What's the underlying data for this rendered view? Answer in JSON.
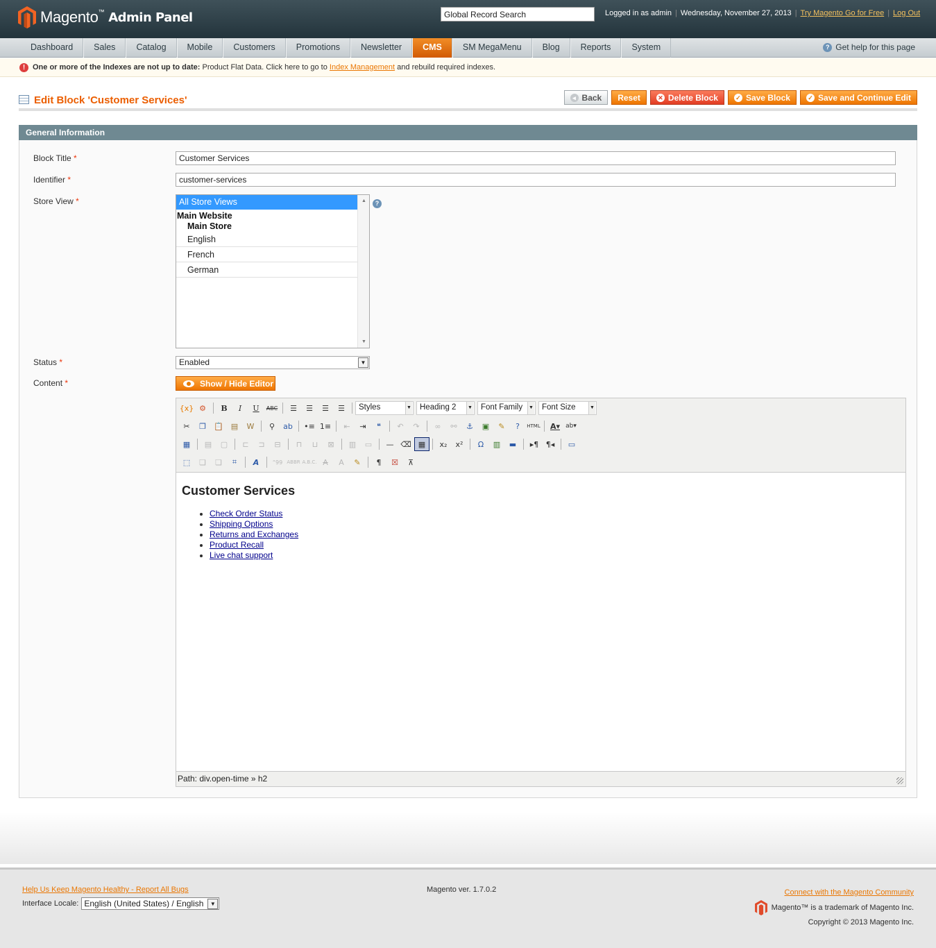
{
  "header": {
    "brand": "Magento",
    "tm": "™",
    "subtitle": "Admin Panel",
    "search_placeholder": "Global Record Search",
    "logged_in": "Logged in as admin",
    "date": "Wednesday, November 27, 2013",
    "try_link": "Try Magento Go for Free",
    "logout": "Log Out"
  },
  "nav": {
    "items": [
      "Dashboard",
      "Sales",
      "Catalog",
      "Mobile",
      "Customers",
      "Promotions",
      "Newsletter",
      "CMS",
      "SM MegaMenu",
      "Blog",
      "Reports",
      "System"
    ],
    "active": "CMS",
    "help": "Get help for this page"
  },
  "notice": {
    "bold": "One or more of the Indexes are not up to date:",
    "text": "Product Flat Data. Click here to go to",
    "link": "Index Management",
    "tail": "and rebuild required indexes."
  },
  "page": {
    "title": "Edit Block 'Customer Services'",
    "buttons": {
      "back": "Back",
      "reset": "Reset",
      "delete": "Delete Block",
      "save": "Save Block",
      "save_continue": "Save and Continue Edit"
    }
  },
  "form": {
    "section": "General Information",
    "block_title_label": "Block Title",
    "block_title": "Customer Services",
    "identifier_label": "Identifier",
    "identifier": "customer-services",
    "store_view_label": "Store View",
    "store_views": {
      "selected": "All Store Views",
      "website": "Main Website",
      "store": "Main Store",
      "views": [
        "English",
        "French",
        "German"
      ]
    },
    "status_label": "Status",
    "status": "Enabled",
    "content_label": "Content",
    "show_hide": "Show / Hide Editor",
    "required_mark": "*"
  },
  "editor": {
    "styles": "Styles",
    "format": "Heading 2",
    "font_family": "Font Family",
    "font_size": "Font Size",
    "heading": "Customer Services",
    "links": [
      "Check Order Status",
      "Shipping Options",
      "Returns and Exchanges",
      "Product Recall",
      "Live chat support"
    ],
    "path": "Path: div.open-time » h2"
  },
  "footer": {
    "report_link": "Help Us Keep Magento Healthy - Report All Bugs",
    "locale_label": "Interface Locale:",
    "locale": "English (United States) / English",
    "version": "Magento ver. 1.7.0.2",
    "community": "Connect with the Magento Community",
    "trademark": "Magento™ is a trademark of Magento Inc.",
    "copyright": "Copyright © 2013 Magento Inc."
  }
}
